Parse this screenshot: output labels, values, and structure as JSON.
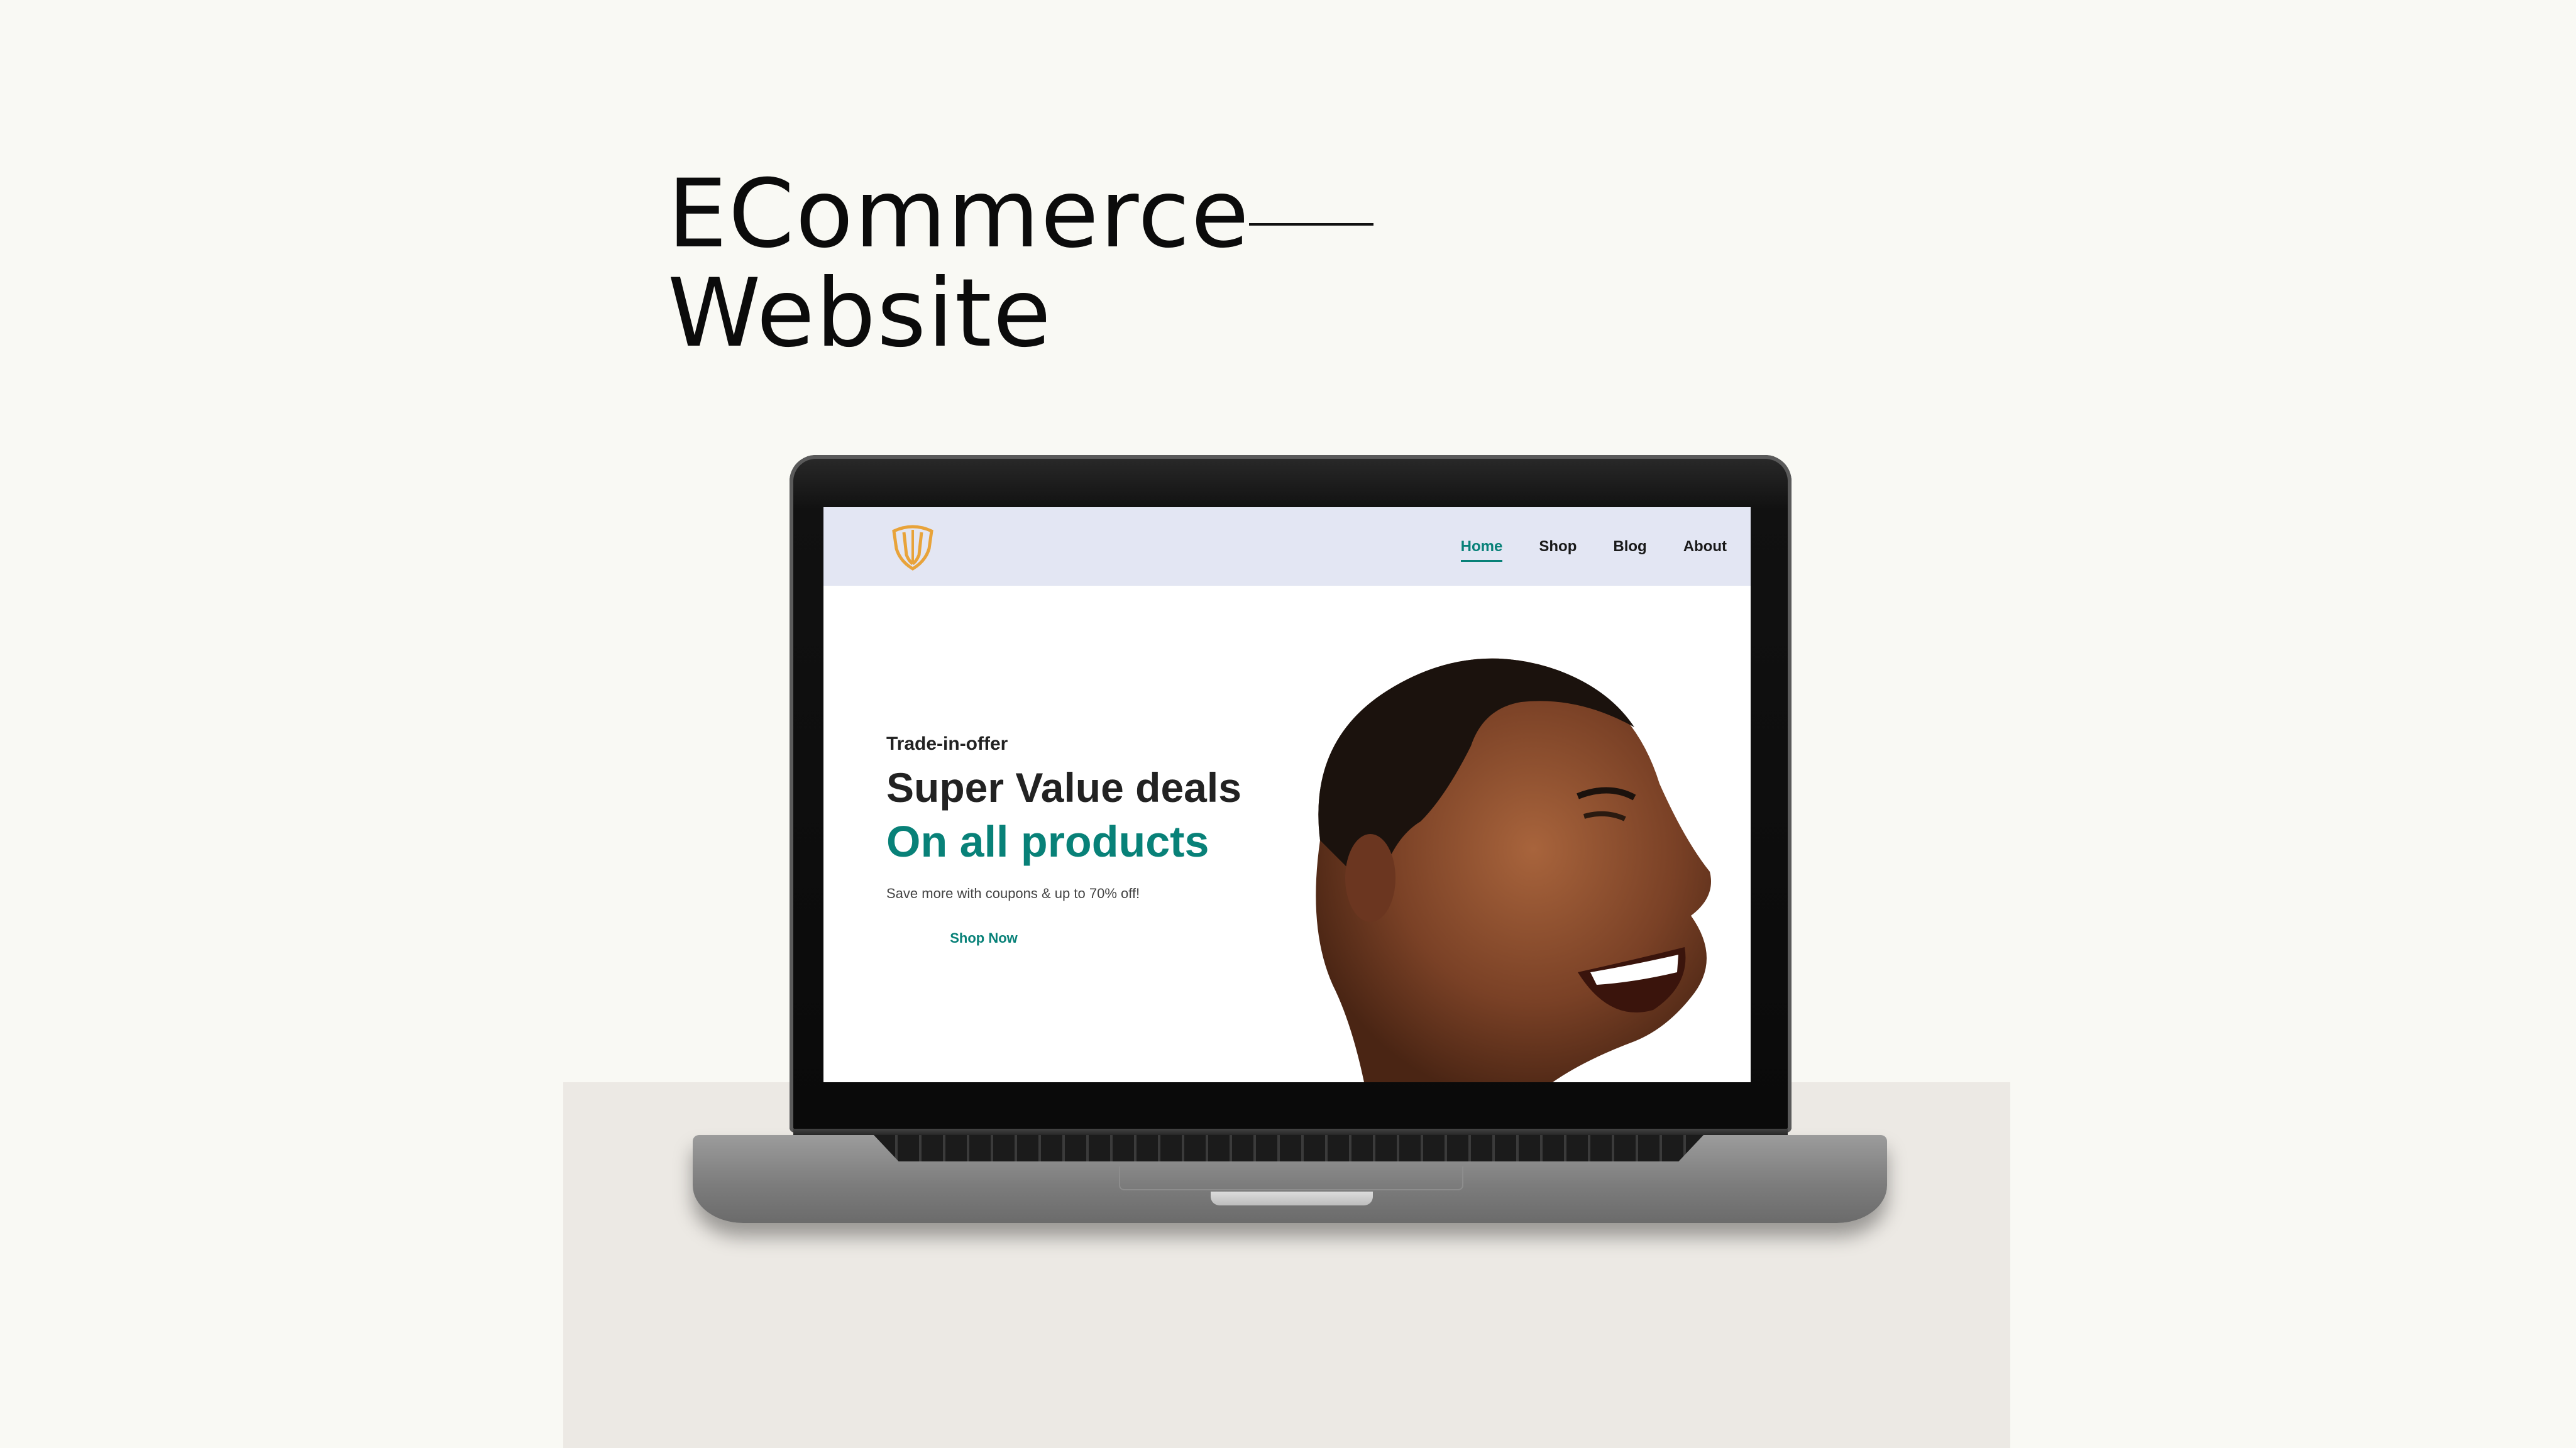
{
  "presentation": {
    "title_line1": "ECommerce",
    "title_line2": "Website"
  },
  "website": {
    "nav": {
      "logo": "shield-logo-icon",
      "items": [
        {
          "label": "Home",
          "active": true
        },
        {
          "label": "Shop",
          "active": false
        },
        {
          "label": "Blog",
          "active": false
        },
        {
          "label": "About",
          "active": false
        }
      ]
    },
    "hero": {
      "kicker": "Trade-in-offer",
      "headline": "Super Value deals",
      "subheadline": "On all products",
      "description": "Save more with coupons & up to 70% off!",
      "button_label": "Shop Now"
    }
  },
  "colors": {
    "accent": "#088178",
    "nav_background": "#e3e6f3",
    "logo": "#e8a33a",
    "page_background": "#f9f9f4",
    "pedestal": "#ece9e4"
  }
}
